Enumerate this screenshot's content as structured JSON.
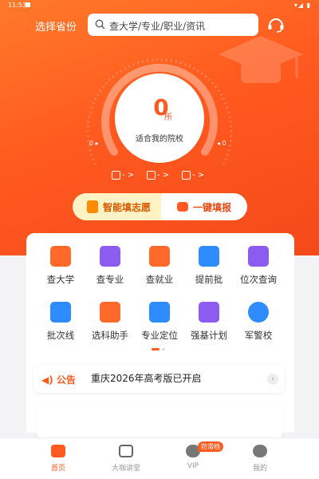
{
  "status": {
    "time": "11:53",
    "right": "▾◢ ▮"
  },
  "header": {
    "province_label": "选择省份",
    "search_placeholder": "查大学/专业/职业/资讯"
  },
  "gauge": {
    "count": "0",
    "unit": "所",
    "caption": "适合我的院校",
    "left_label": "0 ▸",
    "right_label": "◂ 0"
  },
  "mini_links": [
    {
      "text": "- >"
    },
    {
      "text": "- >"
    },
    {
      "text": "- >"
    }
  ],
  "actions": {
    "smart_label": "智能填志愿",
    "quick_label": "一键填报"
  },
  "grid": [
    {
      "label": "查大学",
      "color": "#ff6a2b"
    },
    {
      "label": "查专业",
      "color": "#8c5cf0"
    },
    {
      "label": "查就业",
      "color": "#ff6a2b"
    },
    {
      "label": "提前批",
      "color": "#2f8cff"
    },
    {
      "label": "位次查询",
      "color": "#8c5cf0"
    },
    {
      "label": "批次线",
      "color": "#2f8cff"
    },
    {
      "label": "选科助手",
      "color": "#ff6a2b"
    },
    {
      "label": "专业定位",
      "color": "#2f8cff"
    },
    {
      "label": "强基计划",
      "color": "#8c5cf0"
    },
    {
      "label": "军警校",
      "color": "#2f8cff"
    }
  ],
  "notice": {
    "tag": "公告",
    "text": "重庆2026年高考版已开启"
  },
  "tabs": [
    {
      "label": "首页",
      "active": true
    },
    {
      "label": "大咖讲堂",
      "active": false
    },
    {
      "label": "VIP",
      "active": false
    },
    {
      "label": "我的",
      "active": false
    }
  ],
  "badge": {
    "anti_addiction": "防滑档"
  },
  "colors": {
    "accent": "#ff5a1f",
    "hero_top": "#ff7a2a",
    "hero_bottom": "#f4491a"
  }
}
